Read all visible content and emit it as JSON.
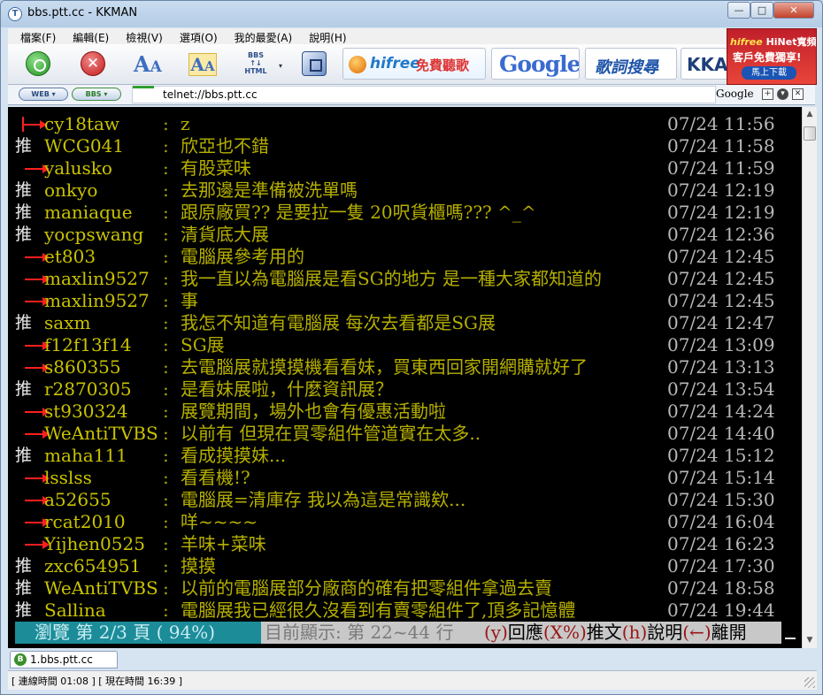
{
  "window": {
    "title": "bbs.ptt.cc - KKMAN",
    "controls": {
      "minimize": "—",
      "maximize": "□",
      "close": "✕"
    }
  },
  "menu": [
    "檔案(F)",
    "編輯(E)",
    "檢視(V)",
    "選項(O)",
    "我的最愛(A)",
    "說明(H)"
  ],
  "toolbar": {
    "bbs_icon_label": "BBS ↑↓ HTML",
    "ads": {
      "hifree": "hifree",
      "hifree_sub": "免費聽歌",
      "google": "Google",
      "sou": "歌詞搜尋",
      "kka": "KKA"
    }
  },
  "promo": {
    "brand": "hifree",
    "line1": " HiNet寬頻",
    "line2": "客戶免費獨享!",
    "button": "馬上下載"
  },
  "address": {
    "mode_web": "WEB ▾",
    "mode_bbs": "BBS ▾",
    "url": "telnet://bbs.ptt.cc",
    "search_label": "Google"
  },
  "comments": [
    {
      "tag": "arrow",
      "user": "cy18taw",
      "msg": "z",
      "time": "07/24 11:56"
    },
    {
      "tag": "推",
      "user": "WCG041",
      "msg": "欣亞也不錯",
      "time": "07/24 11:58"
    },
    {
      "tag": "arrow",
      "user": "yalusko",
      "msg": "有股菜味",
      "time": "07/24 11:59"
    },
    {
      "tag": "推",
      "user": "onkyo",
      "msg": "去那邊是準備被洗單嗎",
      "time": "07/24 12:19"
    },
    {
      "tag": "推",
      "user": "maniaque",
      "msg": "跟原廠買?? 是要拉一隻 20呎貨櫃嗎??? ^_^",
      "time": "07/24 12:19"
    },
    {
      "tag": "推",
      "user": "yocpswang",
      "msg": "清貨底大展",
      "time": "07/24 12:36"
    },
    {
      "tag": "arrow",
      "user": "et803",
      "msg": "電腦展參考用的",
      "time": "07/24 12:45"
    },
    {
      "tag": "arrow",
      "user": "maxlin9527",
      "msg": "我一直以為電腦展是看SG的地方 是一種大家都知道的",
      "time": "07/24 12:45"
    },
    {
      "tag": "arrow",
      "user": "maxlin9527",
      "msg": "事",
      "time": "07/24 12:45"
    },
    {
      "tag": "推",
      "user": "saxm",
      "msg": "我怎不知道有電腦展  每次去看都是SG展",
      "time": "07/24 12:47"
    },
    {
      "tag": "arrow",
      "user": "f12f13f14",
      "msg": "SG展",
      "time": "07/24 13:09"
    },
    {
      "tag": "arrow",
      "user": "s860355",
      "msg": "去電腦展就摸摸機看看妹，買東西回家開網購就好了",
      "time": "07/24 13:13"
    },
    {
      "tag": "推",
      "user": "r2870305",
      "msg": "是看妹展啦，什麼資訊展？",
      "time": "07/24 13:54"
    },
    {
      "tag": "arrow",
      "user": "st930324",
      "msg": "展覽期間，場外也會有優惠活動啦",
      "time": "07/24 14:24"
    },
    {
      "tag": "arrow",
      "user": "WeAntiTVBS",
      "msg": "以前有 但現在買零組件管道實在太多..",
      "time": "07/24 14:40"
    },
    {
      "tag": "推",
      "user": "maha111",
      "msg": "看成摸摸妹...",
      "time": "07/24 15:12"
    },
    {
      "tag": "arrow",
      "user": "lsslss",
      "msg": "      看看機!?",
      "time": "07/24 15:14"
    },
    {
      "tag": "arrow",
      "user": "a52655",
      "msg": "電腦展=清庫存 我以為這是常識欸...",
      "time": "07/24 15:30"
    },
    {
      "tag": "arrow",
      "user": "rcat2010",
      "msg": "咩~~~~",
      "time": "07/24 16:04"
    },
    {
      "tag": "arrow",
      "user": "Yijhen0525",
      "msg": "羊味+菜味",
      "time": "07/24 16:23"
    },
    {
      "tag": "推",
      "user": "zxc654951",
      "msg": "摸摸",
      "time": "07/24 17:30"
    },
    {
      "tag": "推",
      "user": "WeAntiTVBS",
      "msg": "以前的電腦展部分廠商的確有把零組件拿過去賣",
      "time": "07/24 18:58"
    },
    {
      "tag": "推",
      "user": "Sallina",
      "msg": "電腦展我已經很久沒看到有賣零組件了,頂多記憶體",
      "time": "07/24 19:44"
    }
  ],
  "term_status": {
    "browse": "瀏覽 第 2/3 頁 ( 94%)",
    "range": "目前顯示: 第 22~44 行",
    "reply_key": "(y)",
    "reply": "回應",
    "push_key": "(X%)",
    "push": "推文",
    "help_key": "(h)",
    "help": "說明",
    "leave_key": "(←)",
    "leave": "離開"
  },
  "tabs": [
    {
      "icon": "B",
      "label": "1.bbs.ptt.cc"
    }
  ],
  "statusbar": "[ 連線時間 01:08 ] [ 現在時間 16:39 ]",
  "colors": {
    "terminal_bg": "#000000",
    "user": "#c9c300",
    "message": "#b5af00",
    "time": "#b8b8b8",
    "arrow": "#ff1f1f",
    "browse_bar": "#1c8c99"
  }
}
